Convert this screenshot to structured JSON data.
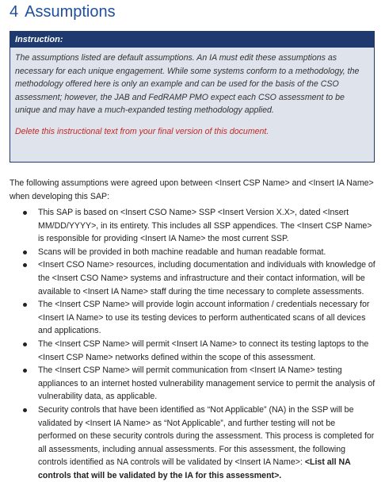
{
  "section": {
    "number": "4",
    "title": "Assumptions"
  },
  "instruction": {
    "header": "Instruction:",
    "body": "The assumptions listed are default assumptions. An IA must edit these assumptions as necessary for each unique engagement. While some systems conform to a methodology, the methodology offered here is only an example and can be used for the basis of the CSO assessment; however, the JAB and FedRAMP PMO expect each CSO assessment to be unique and may have a much-expanded testing methodology applied.",
    "delete_note": "Delete this instructional text from your final version of this document."
  },
  "intro": "The following assumptions were agreed upon between <Insert CSP Name> and <Insert IA Name> when developing this SAP:",
  "assumptions": [
    "This SAP is based on <Insert CSO Name> SSP <Insert Version X.X>, dated <Insert MM/DD/YYYY>, in its entirety. This includes all SSP appendices. The <Insert CSP Name> is responsible for providing <Insert IA Name> the most current SSP.",
    "Scans will be provided in both machine readable and human readable format.",
    "<Insert CSO Name> resources, including documentation and individuals with knowledge of the <Insert CSO Name> systems and infrastructure and their contact information, will be available to <Insert IA Name> staff during the time necessary to complete assessments.",
    "The <Insert CSP Name> will provide login account information / credentials necessary for <Insert IA Name> to use its testing devices to perform authenticated scans of all devices and applications.",
    "The <Insert CSP Name> will permit <Insert IA Name> to connect its testing laptops to the <Insert CSP Name> networks defined within the scope of this assessment.",
    "The <Insert CSP Name> will permit communication from <Insert IA Name> testing appliances to an internet hosted vulnerability management service to permit the analysis of vulnerability data, as applicable.",
    "Security controls that have been identified as “Not Applicable” (NA) in the SSP will be validated by <Insert IA Name> as “Not Applicable”, and further testing will not be performed on these security controls during the assessment. This process is completed for all assessments, including annual assessments. For this assessment, the following controls identified as NA controls will be validated by <Insert IA Name>: "
  ],
  "last_bullet_bold": "<List all NA controls that will be validated by the IA for this assessment>.",
  "colors": {
    "heading": "#1f4e9c",
    "instruction_header_bg": "#1f3a6e",
    "instruction_body_bg": "#dfe3ec",
    "delete_note": "#c62828"
  }
}
